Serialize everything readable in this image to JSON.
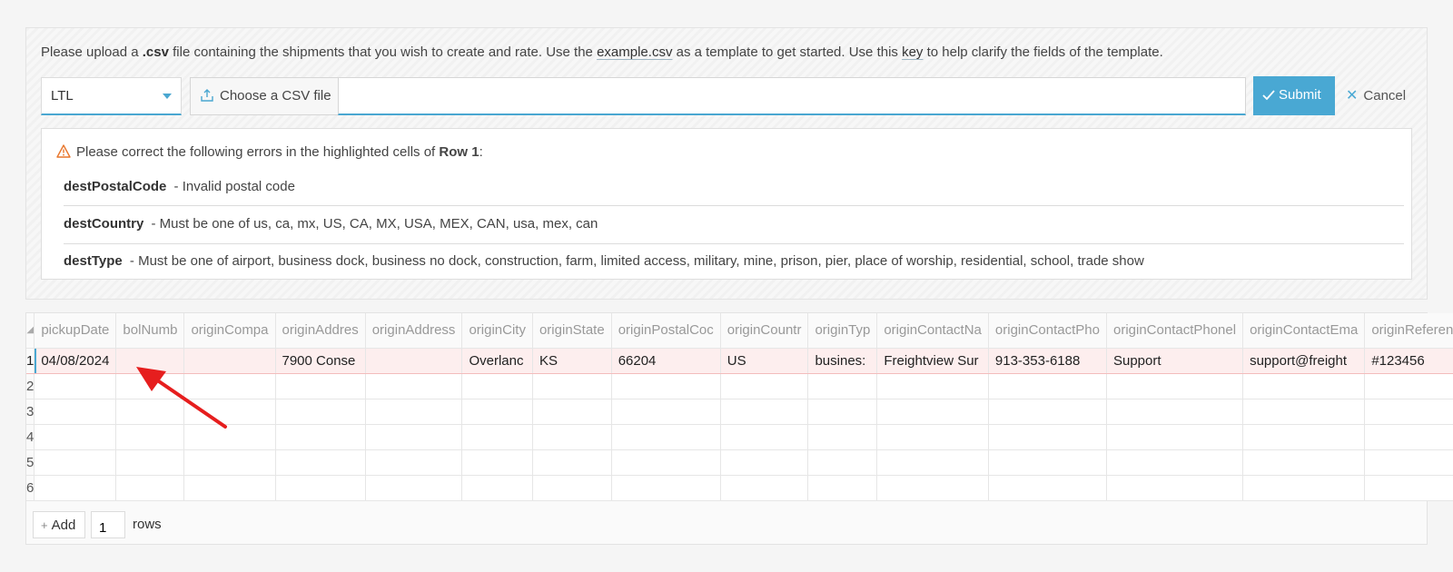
{
  "upload": {
    "intro": {
      "part1": "Please upload a ",
      "csv_bold": ".csv",
      "part2": " file containing the shipments that you wish to create and rate. Use the ",
      "example_link": "example.csv",
      "part3": " as a template to get started. Use this ",
      "key_link": "key",
      "part4": " to help clarify the fields of the template."
    },
    "mode_select": {
      "value": "LTL"
    },
    "file_button_label": "Choose a CSV file",
    "file_input_value": "",
    "submit_label": "Submit",
    "cancel_label": "Cancel"
  },
  "errors": {
    "heading_prefix": "Please correct the following errors in the highlighted cells of ",
    "heading_row": "Row 1",
    "heading_suffix": ":",
    "items": [
      {
        "field": "destPostalCode",
        "message": "- Invalid postal code"
      },
      {
        "field": "destCountry",
        "message": "- Must be one of us, ca, mx, US, CA, MX, USA, MEX, CAN, usa, mex, can"
      },
      {
        "field": "destType",
        "message": "- Must be one of airport, business dock, business no dock, construction, farm, limited access, military, mine, prison, pier, place of worship, residential, school, trade show"
      }
    ]
  },
  "grid": {
    "columns": [
      "pickupDate",
      "bolNumb",
      "originCompa",
      "originAddres",
      "originAddress",
      "originCity",
      "originState",
      "originPostalCoc",
      "originCountr",
      "originTyp",
      "originContactNa",
      "originContactPho",
      "originContactPhonel",
      "originContactEma",
      "originReference"
    ],
    "rows": [
      {
        "num": "1",
        "cells": [
          "04/08/2024",
          "",
          "",
          "7900 Conse",
          "",
          "Overlanc",
          "KS",
          "66204",
          "US",
          "busines:",
          "Freightview Sur",
          "913-353-6188",
          "Support",
          "support@freight",
          "#123456"
        ]
      },
      {
        "num": "2",
        "cells": [
          "",
          "",
          "",
          "",
          "",
          "",
          "",
          "",
          "",
          "",
          "",
          "",
          "",
          "",
          ""
        ]
      },
      {
        "num": "3",
        "cells": [
          "",
          "",
          "",
          "",
          "",
          "",
          "",
          "",
          "",
          "",
          "",
          "",
          "",
          "",
          ""
        ]
      },
      {
        "num": "4",
        "cells": [
          "",
          "",
          "",
          "",
          "",
          "",
          "",
          "",
          "",
          "",
          "",
          "",
          "",
          "",
          ""
        ]
      },
      {
        "num": "5",
        "cells": [
          "",
          "",
          "",
          "",
          "",
          "",
          "",
          "",
          "",
          "",
          "",
          "",
          "",
          "",
          ""
        ]
      },
      {
        "num": "6",
        "cells": [
          "",
          "",
          "",
          "",
          "",
          "",
          "",
          "",
          "",
          "",
          "",
          "",
          "",
          "",
          ""
        ]
      }
    ]
  },
  "add_rows": {
    "button_label": "Add",
    "count": "1",
    "suffix": "rows"
  },
  "colors": {
    "accent": "#49a8d3",
    "error_row": "#fdeeee",
    "warning": "#e8762c",
    "annotation_arrow": "#e61e1e"
  }
}
